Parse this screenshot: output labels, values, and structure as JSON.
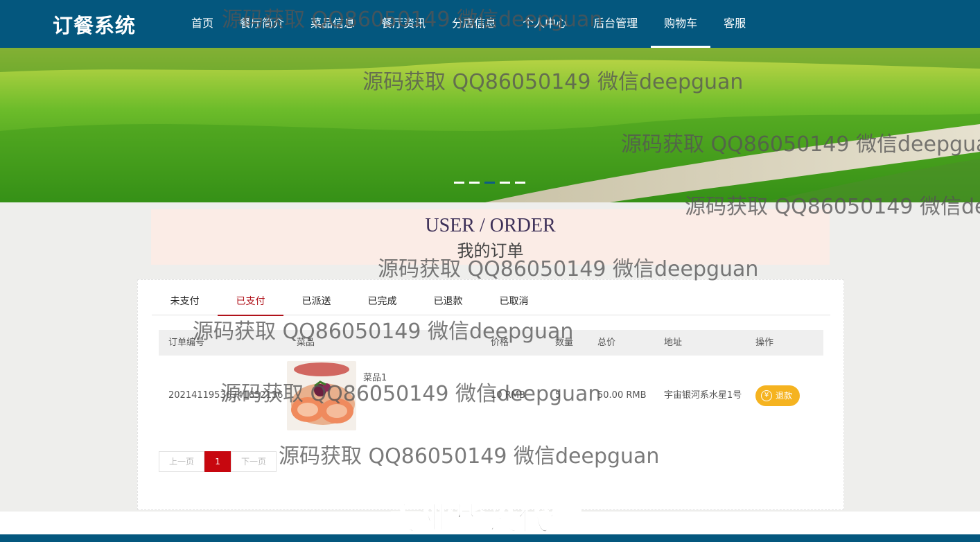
{
  "header": {
    "logo": "订餐系统",
    "nav": [
      "首页",
      "餐厅简介",
      "菜品信息",
      "餐厅资讯",
      "分店信息",
      "个人中心",
      "后台管理",
      "购物车",
      "客服"
    ],
    "active_nav": "购物车"
  },
  "banner": {
    "slide_count": 5,
    "current_slide": 3
  },
  "page_title": {
    "en": "USER / ORDER",
    "cn": "我的订单"
  },
  "tabs": [
    "未支付",
    "已支付",
    "已派送",
    "已完成",
    "已退款",
    "已取消"
  ],
  "active_tab": "已支付",
  "table": {
    "headers": [
      "订单编号",
      "菜品",
      "价格",
      "数量",
      "总价",
      "地址",
      "操作"
    ],
    "rows": [
      {
        "order_no": "20214119536341652136",
        "dish_name": "菜品1",
        "price": "10 RMB",
        "quantity": "5",
        "total": "50.00 RMB",
        "address": "宇宙银河系水星1号",
        "action": "退款",
        "action_icon": "¥"
      }
    ]
  },
  "pagination": {
    "prev": "上一页",
    "current": "1",
    "next": "下一页"
  },
  "watermark": {
    "text": "源码获取 QQ86050149 微信deepguan",
    "big": "专业毕设代做"
  },
  "colors": {
    "header": "#04577e",
    "active_tab": "#b0121a",
    "refund": "#f5b320",
    "page_current": "#c7070f"
  }
}
